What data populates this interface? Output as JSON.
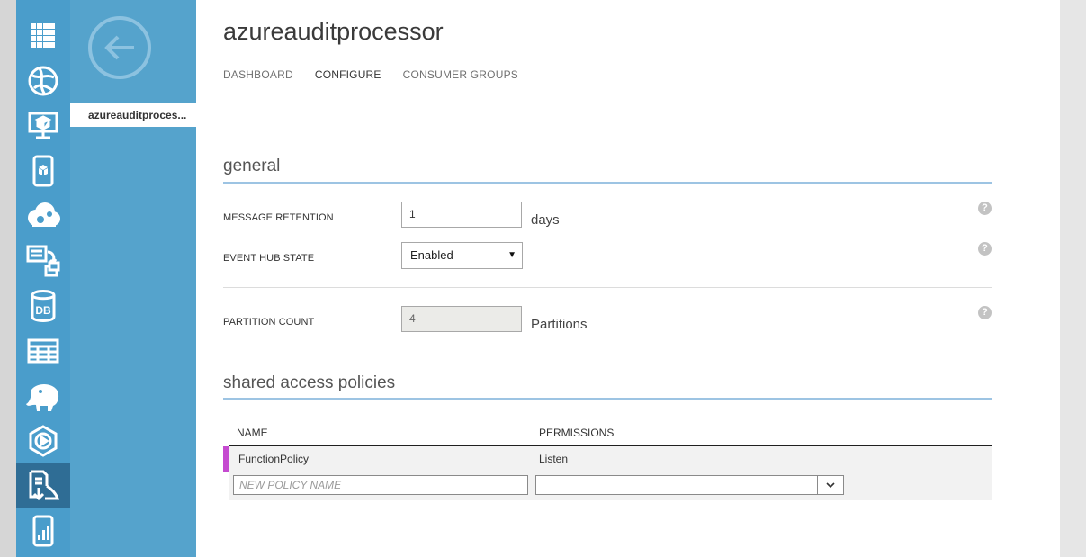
{
  "page": {
    "title": "azureauditprocessor",
    "tabs": [
      {
        "label": "DASHBOARD",
        "active": false
      },
      {
        "label": "CONFIGURE",
        "active": true
      },
      {
        "label": "CONSUMER GROUPS",
        "active": false
      }
    ]
  },
  "subnav": {
    "item_label": "azureauditproces..."
  },
  "iconbar": {
    "items": [
      {
        "icon": "all-items-grid-icon"
      },
      {
        "icon": "web-sites-icon"
      },
      {
        "icon": "virtual-machines-icon"
      },
      {
        "icon": "mobile-services-icon"
      },
      {
        "icon": "cloud-services-icon"
      },
      {
        "icon": "batch-services-icon"
      },
      {
        "icon": "sql-databases-icon",
        "text": "DB"
      },
      {
        "icon": "storage-table-icon"
      },
      {
        "icon": "hdinsight-elephant-icon"
      },
      {
        "icon": "media-services-icon"
      },
      {
        "icon": "service-bus-icon",
        "active": true
      },
      {
        "icon": "mobile-engagement-icon"
      }
    ]
  },
  "general": {
    "section_title": "general",
    "message_retention": {
      "label": "MESSAGE RETENTION",
      "value": "1",
      "unit": "days"
    },
    "event_hub_state": {
      "label": "EVENT HUB STATE",
      "value": "Enabled"
    },
    "partition_count": {
      "label": "PARTITION COUNT",
      "value": "4",
      "unit": "Partitions"
    },
    "help_glyph": "?"
  },
  "policies": {
    "section_title": "shared access policies",
    "columns": [
      "NAME",
      "PERMISSIONS"
    ],
    "rows": [
      {
        "name": "FunctionPolicy",
        "permissions": "Listen"
      }
    ],
    "new_policy_placeholder": "NEW POLICY NAME",
    "new_permission_value": ""
  },
  "colors": {
    "iconbar": "#4a9dcb",
    "subnav": "#55a3cc",
    "active_nav": "#2f6d95",
    "section_rule": "#9dc4e3",
    "row_marker": "#c54ad0"
  }
}
